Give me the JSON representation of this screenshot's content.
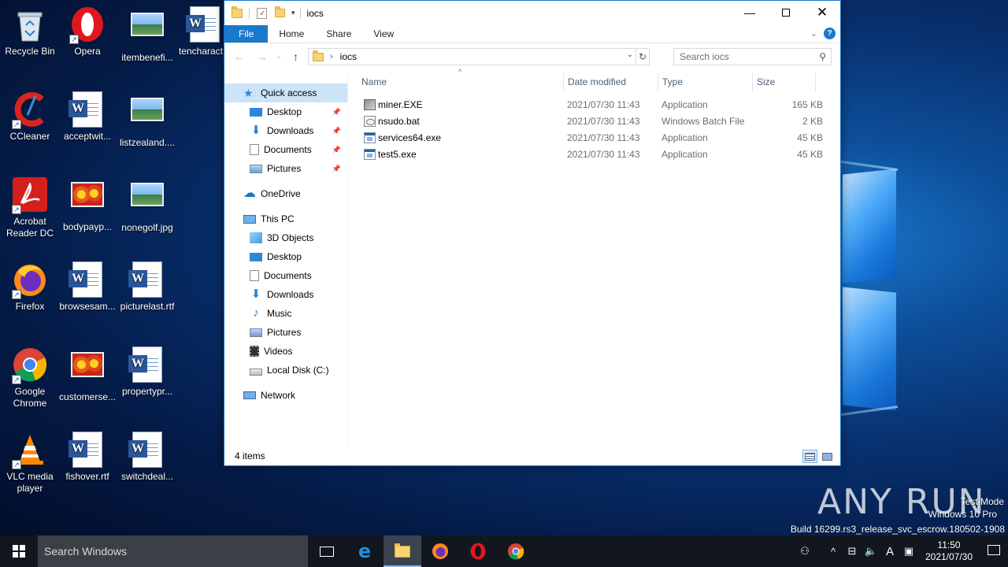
{
  "desktop": {
    "icons": [
      {
        "label": "Recycle Bin"
      },
      {
        "label": "Opera"
      },
      {
        "label": "itembenefi..."
      },
      {
        "label": "tencharact..."
      },
      {
        "label": "CCleaner"
      },
      {
        "label": "acceptwit..."
      },
      {
        "label": "listzealand...."
      },
      {
        "label": "Acrobat Reader DC"
      },
      {
        "label": "bodypayp..."
      },
      {
        "label": "nonegolf.jpg"
      },
      {
        "label": "Firefox"
      },
      {
        "label": "browsesam..."
      },
      {
        "label": "picturelast.rtf"
      },
      {
        "label": "Google Chrome"
      },
      {
        "label": "customerse..."
      },
      {
        "label": "propertypr..."
      },
      {
        "label": "VLC media player"
      },
      {
        "label": "fishover.rtf"
      },
      {
        "label": "switchdeal..."
      }
    ]
  },
  "explorer": {
    "title": "iocs",
    "tabs": [
      "File",
      "Home",
      "Share",
      "View"
    ],
    "address_path": "iocs",
    "search_placeholder": "Search iocs",
    "nav": {
      "quick_access": "Quick access",
      "quick_items": [
        "Desktop",
        "Downloads",
        "Documents",
        "Pictures"
      ],
      "onedrive": "OneDrive",
      "this_pc": "This PC",
      "pc_items": [
        "3D Objects",
        "Desktop",
        "Documents",
        "Downloads",
        "Music",
        "Pictures",
        "Videos",
        "Local Disk (C:)"
      ],
      "network": "Network"
    },
    "columns": {
      "name": "Name",
      "date": "Date modified",
      "type": "Type",
      "size": "Size"
    },
    "files": [
      {
        "name": "miner.EXE",
        "date": "2021/07/30 11:43",
        "type": "Application",
        "size": "165 KB",
        "icon": "miner-icon"
      },
      {
        "name": "nsudo.bat",
        "date": "2021/07/30 11:43",
        "type": "Windows Batch File",
        "size": "2 KB",
        "icon": "batch-file-icon"
      },
      {
        "name": "services64.exe",
        "date": "2021/07/30 11:43",
        "type": "Application",
        "size": "45 KB",
        "icon": "application-icon"
      },
      {
        "name": "test5.exe",
        "date": "2021/07/30 11:43",
        "type": "Application",
        "size": "45 KB",
        "icon": "application-icon"
      }
    ],
    "status_count": "4 items"
  },
  "taskbar": {
    "search_text": "Search Windows",
    "time": "11:50",
    "date": "2021/07/30",
    "ime": "A"
  },
  "watermark": {
    "brand": "ANY RUN",
    "line1": "Test Mode",
    "line2": "Windows 10 Pro",
    "line3": "Build 16299.rs3_release_svc_escrow.180502-1908"
  },
  "colors": {
    "accent": "#1979ca",
    "selection": "#cce4f7",
    "taskbar": "#11161f"
  }
}
